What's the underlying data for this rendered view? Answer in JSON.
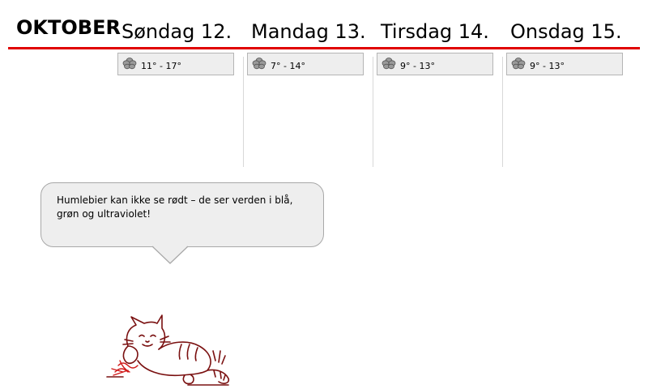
{
  "header": {
    "month": "OKTOBER",
    "accent_color": "#e00000"
  },
  "days": [
    {
      "label": "Søndag 12.",
      "weather_icon": "cloud-icon",
      "temp": "11° - 17°"
    },
    {
      "label": "Mandag 13.",
      "weather_icon": "cloud-icon",
      "temp": "7° - 14°"
    },
    {
      "label": "Tirsdag 14.",
      "weather_icon": "cloud-icon",
      "temp": "9° - 13°"
    },
    {
      "label": "Onsdag 15.",
      "weather_icon": "cloud-icon",
      "temp": "9° - 13°"
    }
  ],
  "fact": {
    "text": "Humlebier kan ikke se rødt – de ser verden i blå, grøn og ultraviolet!"
  },
  "mascot": {
    "icon": "cat-illustration"
  }
}
